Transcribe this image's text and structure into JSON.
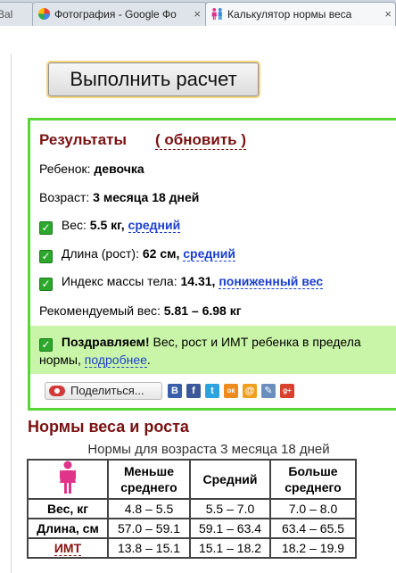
{
  "browser": {
    "tabs": [
      {
        "title": "Bal",
        "icon": "page-icon"
      },
      {
        "title": "Фотография - Google Фо",
        "icon": "google-photos-icon"
      },
      {
        "title": "Калькулятор нормы веса",
        "icon": "family-icon"
      }
    ],
    "close_glyph": "×"
  },
  "calc_button": {
    "label": "Выполнить расчет"
  },
  "results": {
    "title": "Результаты",
    "refresh_label": "( обновить )",
    "child_label": "Ребенок:",
    "child_value": "девочка",
    "age_label": "Возраст:",
    "age_value": "3 месяца 18 дней",
    "weight_label": "Вес:",
    "weight_value": "5.5 кг,",
    "weight_status": "средний",
    "length_label": "Длина (рост):",
    "length_value": "62 см,",
    "length_status": "средний",
    "bmi_label": "Индекс массы тела:",
    "bmi_value": "14.31,",
    "bmi_status": "пониженный вес",
    "recommended_label": "Рекомендуемый вес:",
    "recommended_value": "5.81 – 6.98 кг",
    "congrats_bold": "Поздравляем!",
    "congrats_text": "Вес, рост и ИМТ ребенка в предела",
    "congrats_line2": "нормы,",
    "congrats_link": "подробнее",
    "congrats_end": ".",
    "share_label": "Поделиться...",
    "social": [
      {
        "icon": "bookmark-b-icon",
        "glyph": "B",
        "color": "#3a5fa8"
      },
      {
        "icon": "facebook-icon",
        "glyph": "f",
        "color": "#3b5998"
      },
      {
        "icon": "twitter-icon",
        "glyph": "t",
        "color": "#2ba3e0"
      },
      {
        "icon": "odnoklassniki-icon",
        "glyph": "ок",
        "color": "#f08a1c"
      },
      {
        "icon": "mail-icon",
        "glyph": "@",
        "color": "#f0a020"
      },
      {
        "icon": "livejournal-icon",
        "glyph": "✎",
        "color": "#6a8fbf"
      },
      {
        "icon": "google-plus-icon",
        "glyph": "g+",
        "color": "#d6422f"
      }
    ]
  },
  "norms": {
    "title": "Нормы веса и роста",
    "subtitle": "Нормы для возраста 3 месяца 18 дней",
    "columns": [
      "Меньше среднего",
      "Средний",
      "Больше среднего"
    ],
    "rows": [
      {
        "label": "Вес, кг",
        "values": [
          "4.8 – 5.5",
          "5.5 – 7.0",
          "7.0 – 8.0"
        ]
      },
      {
        "label": "Длина, см",
        "values": [
          "57.0 – 59.1",
          "59.1 – 63.4",
          "63.4 – 65.5"
        ]
      },
      {
        "label": "ИМТ",
        "values": [
          "13.8 – 15.1",
          "15.1 – 18.2",
          "18.2 – 19.9"
        ]
      }
    ]
  }
}
